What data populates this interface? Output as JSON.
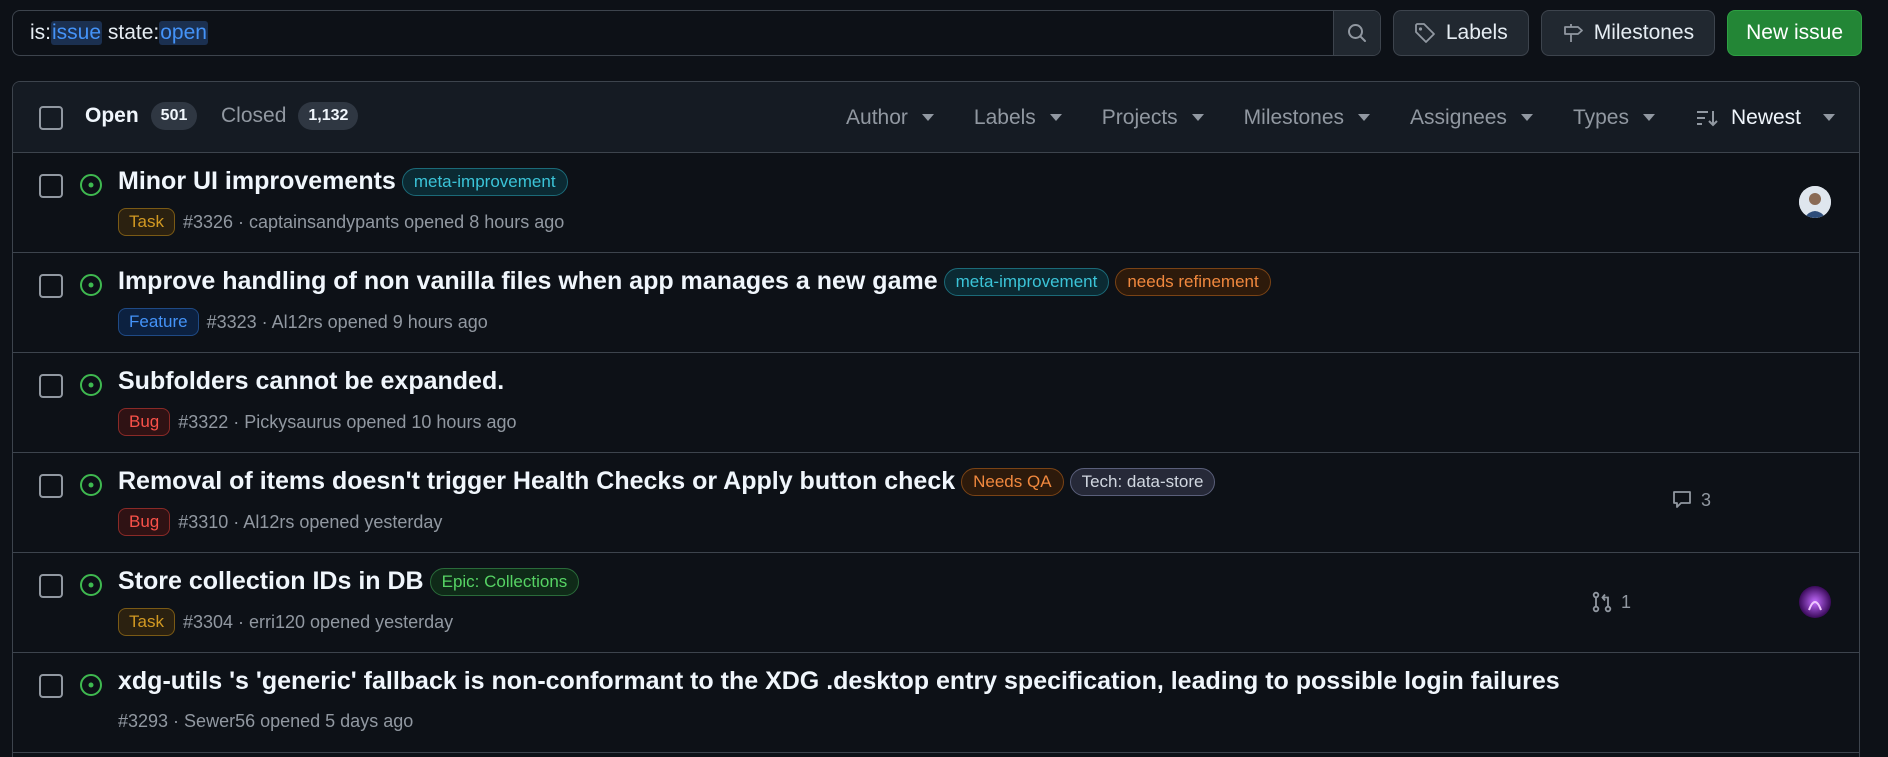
{
  "search": {
    "prefix1": "is:",
    "token1": "issue",
    "prefix2": " state:",
    "token2": "open",
    "button_icon": "search-icon"
  },
  "toolbar": {
    "labels_label": "Labels",
    "milestones_label": "Milestones",
    "new_issue_label": "New issue"
  },
  "header": {
    "open_label": "Open",
    "open_count": "501",
    "closed_label": "Closed",
    "closed_count": "1,132",
    "filters": {
      "author": "Author",
      "labels": "Labels",
      "projects": "Projects",
      "milestones": "Milestones",
      "assignees": "Assignees",
      "types": "Types",
      "sort": "Newest"
    }
  },
  "colors": {
    "open_icon": "#3fb950",
    "accent_green": "#238636",
    "link_blue": "#4493f8"
  },
  "issues": [
    {
      "title": "Minor UI improvements",
      "labels": [
        "meta-improvement"
      ],
      "type": "Task",
      "meta": "#3326 · captainsandypants opened 8 hours ago"
    },
    {
      "title": "Improve handling of non vanilla files when app manages a new game",
      "labels": [
        "meta-improvement",
        "needs refinement"
      ],
      "type": "Feature",
      "meta": "#3323 · Al12rs opened 9 hours ago"
    },
    {
      "title": "Subfolders cannot be expanded.",
      "labels": [],
      "type": "Bug",
      "meta": "#3322 · Pickysaurus opened 10 hours ago"
    },
    {
      "title": "Removal of items doesn't trigger Health Checks or Apply button check",
      "labels": [
        "Needs QA",
        "Tech: data-store"
      ],
      "type": "Bug",
      "meta": "#3310 · Al12rs opened yesterday",
      "comments": "3"
    },
    {
      "title": "Store collection IDs in DB",
      "labels": [
        "Epic: Collections"
      ],
      "type": "Task",
      "meta": "#3304 · erri120 opened yesterday",
      "linked_prs": "1"
    },
    {
      "title": "xdg-utils 's 'generic' fallback is non-conformant to the XDG .desktop entry specification, leading to possible login failures",
      "labels": [],
      "type": "",
      "meta": "#3293 · Sewer56 opened 5 days ago"
    }
  ]
}
